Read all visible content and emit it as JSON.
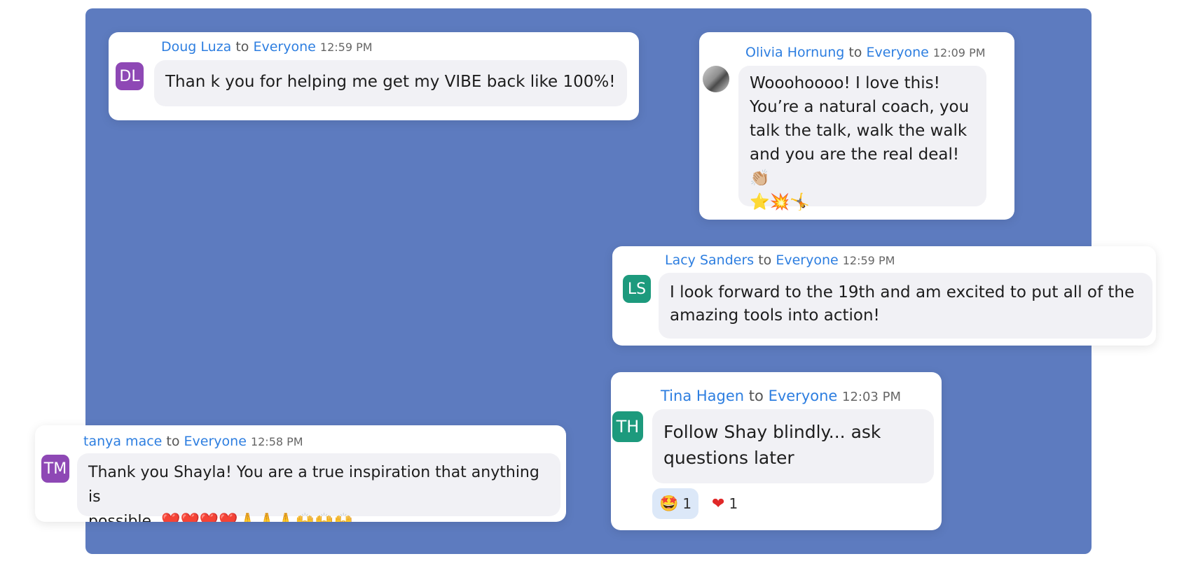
{
  "messages": [
    {
      "sender": "Doug Luza",
      "to_word": "to",
      "target": "Everyone",
      "time": "12:59 PM",
      "avatar": "DL",
      "avatar_color": "#8e48b5",
      "text": "Than k you for helping me get my VIBE back like 100%!"
    },
    {
      "sender": "Olivia Hornung",
      "to_word": "to",
      "target": "Everyone",
      "time": "12:09 PM",
      "avatar_icon": "profile-photo",
      "text_lines": [
        "Wooohoooo! I love this!",
        "You’re a natural coach, you",
        "talk the talk, walk the walk",
        "and you are the real deal! 👏🏼",
        "⭐💥🤸"
      ]
    },
    {
      "sender": "Lacy Sanders",
      "to_word": "to",
      "target": "Everyone",
      "time": "12:59 PM",
      "avatar": "LS",
      "avatar_color": "#1d9a7d",
      "text_lines": [
        "I look forward to the 19th and am excited to put all of the",
        "amazing tools into action!"
      ]
    },
    {
      "sender": "Tina Hagen",
      "to_word": "to",
      "target": "Everyone",
      "time": "12:03 PM",
      "avatar": "TH",
      "avatar_color": "#1d9a7d",
      "text_lines": [
        "Follow Shay blindly... ask",
        "questions later"
      ],
      "reactions": [
        {
          "emoji": "🤩",
          "count": "1",
          "selected": true
        },
        {
          "emoji": "❤",
          "count": "1",
          "selected": false
        }
      ]
    },
    {
      "sender": "tanya mace",
      "to_word": "to",
      "target": "Everyone",
      "time": "12:58 PM",
      "avatar": "TM",
      "avatar_color": "#8e48b5",
      "text_lines": [
        "Thank you Shayla! You are a true inspiration that anything is",
        "possible. ❤️❤️❤️❤️🙏🙏🙏🙌🙌🙌"
      ]
    }
  ],
  "colors": {
    "panel": "#5d7bbf",
    "link": "#2d7ee0",
    "bubble": "#f1f1f5"
  }
}
